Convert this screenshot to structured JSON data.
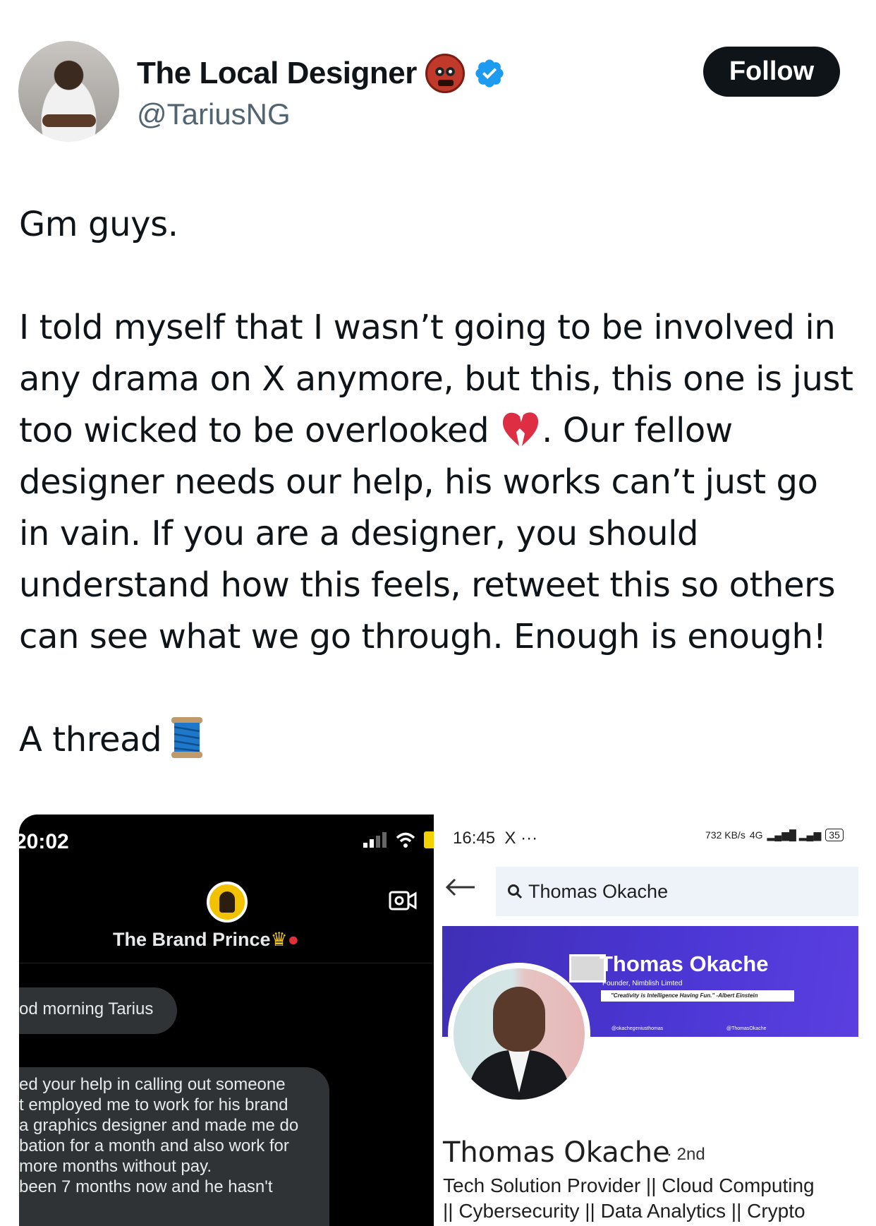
{
  "tweet": {
    "author": {
      "display_name": "The Local Designer",
      "handle": "@TariusNG",
      "name_emoji_icon": "ogre-icon",
      "verified_icon": "verified-badge-icon"
    },
    "follow_label": "Follow",
    "text": {
      "p1": "Gm guys.",
      "p2_line1": "I told myself that I wasn’t going to be involved in",
      "p2_line2": "any drama on X anymore, but this, this one is just",
      "p2_line3a": "too wicked to be overlooked ",
      "p2_line3b": ". Our fellow",
      "p2_line4": "designer needs our help, his works can’t just go",
      "p2_line5": "in vain. If you are a designer, you should",
      "p2_line6": "understand how this feels, retweet this so others",
      "p2_line7": "can see what we go through. Enough is enough!",
      "p3": "A thread"
    },
    "colors": {
      "text": "#0f1419",
      "handle": "#536471",
      "verified": "#1d9bf0",
      "follow_bg": "#0f1419"
    }
  },
  "media_left": {
    "status_time": "20:02",
    "contact_name": "The Brand Prince",
    "contact_emojis": [
      "crown-icon",
      "balloon-icon"
    ],
    "bubble_1": "od morning Tarius",
    "bubble_2_lines": [
      "ed your help in calling out someone",
      "t employed me to work for his brand",
      "a graphics designer and made me do",
      "bation for a month and also work for",
      "more months without pay.",
      "",
      "been 7 months now and he hasn't"
    ]
  },
  "media_right": {
    "status_time": "16:45",
    "status_extra": "X ···",
    "network_speed": "732 KB/s",
    "network_type": "4G",
    "battery": "35",
    "search_value": "Thomas Okache",
    "banner": {
      "name": "Thomas Okache",
      "role": "Founder, Nimblish Limted",
      "quote": "\"Creativity is Intelligence Having Fun.\" -Albert Einstein",
      "social_1": "@okachegeniusthomas",
      "social_2": "@ThomasOkache"
    },
    "profile_name": "Thomas Okache",
    "degree": "· 2nd",
    "headline": "Tech Solution Provider || Cloud Computing\n|| Cybersecurity || Data Analytics || Crypto",
    "colors": {
      "banner": "#4b36d4",
      "search_bg": "#edf3f8"
    }
  }
}
